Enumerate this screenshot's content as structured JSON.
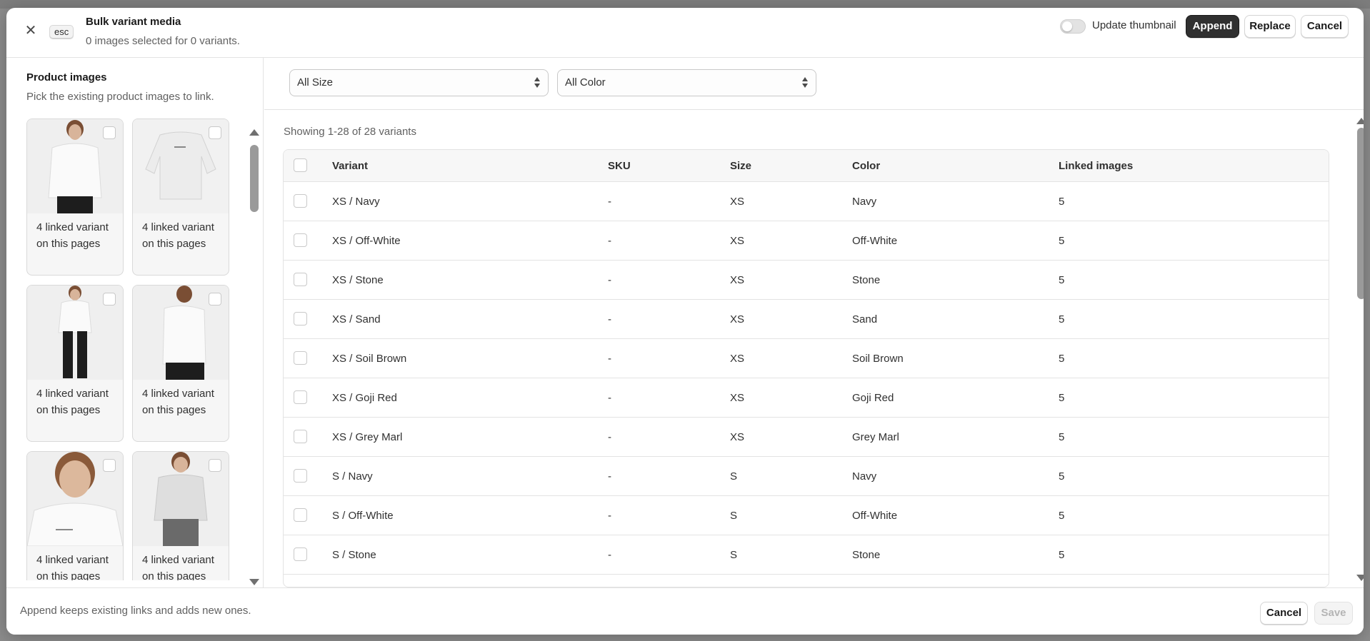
{
  "header": {
    "close_icon": "close-icon",
    "esc_label": "esc",
    "title": "Bulk variant media",
    "subtitle": "0 images selected for 0 variants.",
    "toggle_label": "Update thumbnail",
    "append_label": "Append",
    "replace_label": "Replace",
    "cancel_label": "Cancel"
  },
  "left_panel": {
    "title": "Product images",
    "subtitle": "Pick the existing product images to link.",
    "cards": [
      {
        "caption": "4 linked variant on this pages",
        "image": "model-front-white-sweatshirt"
      },
      {
        "caption": "4 linked variant on this pages",
        "image": "flat-white-sweatshirt"
      },
      {
        "caption": "4 linked variant on this pages",
        "image": "model-full-length-sweatshirt"
      },
      {
        "caption": "4 linked variant on this pages",
        "image": "model-back-white-sweatshirt"
      },
      {
        "caption": "4 linked variant on this pages",
        "image": "model-closeup-white-sweatshirt"
      },
      {
        "caption": "4 linked variant on this pages",
        "image": "model-grey-sweatshirt"
      }
    ]
  },
  "filters": {
    "size_value": "All Size",
    "color_value": "All Color"
  },
  "table": {
    "showing": "Showing 1-28 of 28 variants",
    "headers": [
      "Variant",
      "SKU",
      "Size",
      "Color",
      "Linked images"
    ],
    "rows": [
      {
        "variant": "XS / Navy",
        "sku": "-",
        "size": "XS",
        "color": "Navy",
        "linked": "5"
      },
      {
        "variant": "XS / Off-White",
        "sku": "-",
        "size": "XS",
        "color": "Off-White",
        "linked": "5"
      },
      {
        "variant": "XS / Stone",
        "sku": "-",
        "size": "XS",
        "color": "Stone",
        "linked": "5"
      },
      {
        "variant": "XS / Sand",
        "sku": "-",
        "size": "XS",
        "color": "Sand",
        "linked": "5"
      },
      {
        "variant": "XS / Soil Brown",
        "sku": "-",
        "size": "XS",
        "color": "Soil Brown",
        "linked": "5"
      },
      {
        "variant": "XS / Goji Red",
        "sku": "-",
        "size": "XS",
        "color": "Goji Red",
        "linked": "5"
      },
      {
        "variant": "XS / Grey Marl",
        "sku": "-",
        "size": "XS",
        "color": "Grey Marl",
        "linked": "5"
      },
      {
        "variant": "S / Navy",
        "sku": "-",
        "size": "S",
        "color": "Navy",
        "linked": "5"
      },
      {
        "variant": "S / Off-White",
        "sku": "-",
        "size": "S",
        "color": "Off-White",
        "linked": "5"
      },
      {
        "variant": "S / Stone",
        "sku": "-",
        "size": "S",
        "color": "Stone",
        "linked": "5"
      }
    ]
  },
  "footer": {
    "note": "Append keeps existing links and adds new ones.",
    "cancel_label": "Cancel",
    "save_label": "Save"
  },
  "colors": {
    "primary_button": "#303030",
    "border": "#e3e3e3",
    "muted_text": "#616161"
  }
}
